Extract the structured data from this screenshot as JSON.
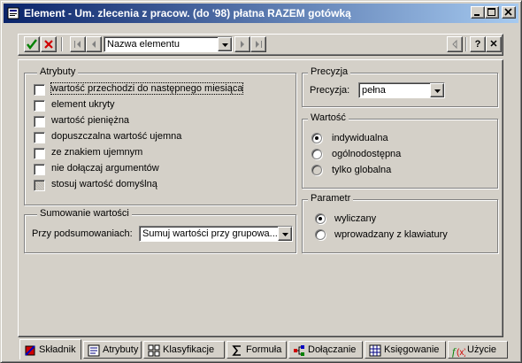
{
  "window": {
    "title": "Element - Um. zlecenia z pracow. (do '98) płatna RAZEM gotówką",
    "controls": [
      "minimize-icon",
      "maximize-icon",
      "close-icon"
    ]
  },
  "toolbar": {
    "confirm_icon": "checkmark-icon",
    "cancel_icon": "red-x-icon",
    "nav_icons": [
      "first-icon",
      "previous-icon",
      "next-icon",
      "last-icon"
    ],
    "element_select": {
      "value": "Nazwa elementu"
    },
    "help_label": "?",
    "close_label": "✕"
  },
  "atrybuty": {
    "legend": "Atrybuty",
    "items": [
      {
        "label": "wartość przechodzi do następnego miesiąca",
        "checked": false,
        "disabled": false
      },
      {
        "label": "element ukryty",
        "checked": false,
        "disabled": false
      },
      {
        "label": "wartość pieniężna",
        "checked": false,
        "disabled": false
      },
      {
        "label": "dopuszczalna wartość ujemna",
        "checked": false,
        "disabled": false
      },
      {
        "label": "ze znakiem ujemnym",
        "checked": false,
        "disabled": false
      },
      {
        "label": "nie dołączaj argumentów",
        "checked": false,
        "disabled": false
      },
      {
        "label": "stosuj wartość domyślną",
        "checked": false,
        "disabled": true
      }
    ]
  },
  "sumowanie": {
    "legend": "Sumowanie wartości",
    "label": "Przy podsumowaniach:",
    "value": "Sumuj wartości przy grupowa..."
  },
  "precyzja": {
    "legend": "Precyzja",
    "label": "Precyzja:",
    "value": "pełna"
  },
  "wartosc": {
    "legend": "Wartość",
    "options": [
      {
        "label": "indywidualna",
        "selected": true,
        "disabled": false
      },
      {
        "label": "ogólnodostępna",
        "selected": false,
        "disabled": false
      },
      {
        "label": "tylko globalna",
        "selected": false,
        "disabled": true
      }
    ]
  },
  "parametr": {
    "legend": "Parametr",
    "options": [
      {
        "label": "wyliczany",
        "selected": true
      },
      {
        "label": "wprowadzany z klawiatury",
        "selected": false
      }
    ]
  },
  "tabs": [
    {
      "label": "Składnik",
      "icon": "component-icon",
      "active": true
    },
    {
      "label": "Atrybuty",
      "icon": "attributes-icon",
      "active": false
    },
    {
      "label": "Klasyfikacje",
      "icon": "classification-icon",
      "active": false
    },
    {
      "label": "Formuła",
      "icon": "formula-icon",
      "active": false
    },
    {
      "label": "Dołączanie",
      "icon": "joining-icon",
      "active": false
    },
    {
      "label": "Księgowanie",
      "icon": "ledger-icon",
      "active": false
    },
    {
      "label": "Użycie",
      "icon": "usage-function-icon",
      "active": false
    }
  ],
  "colors": {
    "titlebar_start": "#0a246a",
    "titlebar_end": "#a6caf0",
    "face": "#d4d0c8",
    "confirm_green": "#008000",
    "cancel_red": "#d00000"
  }
}
